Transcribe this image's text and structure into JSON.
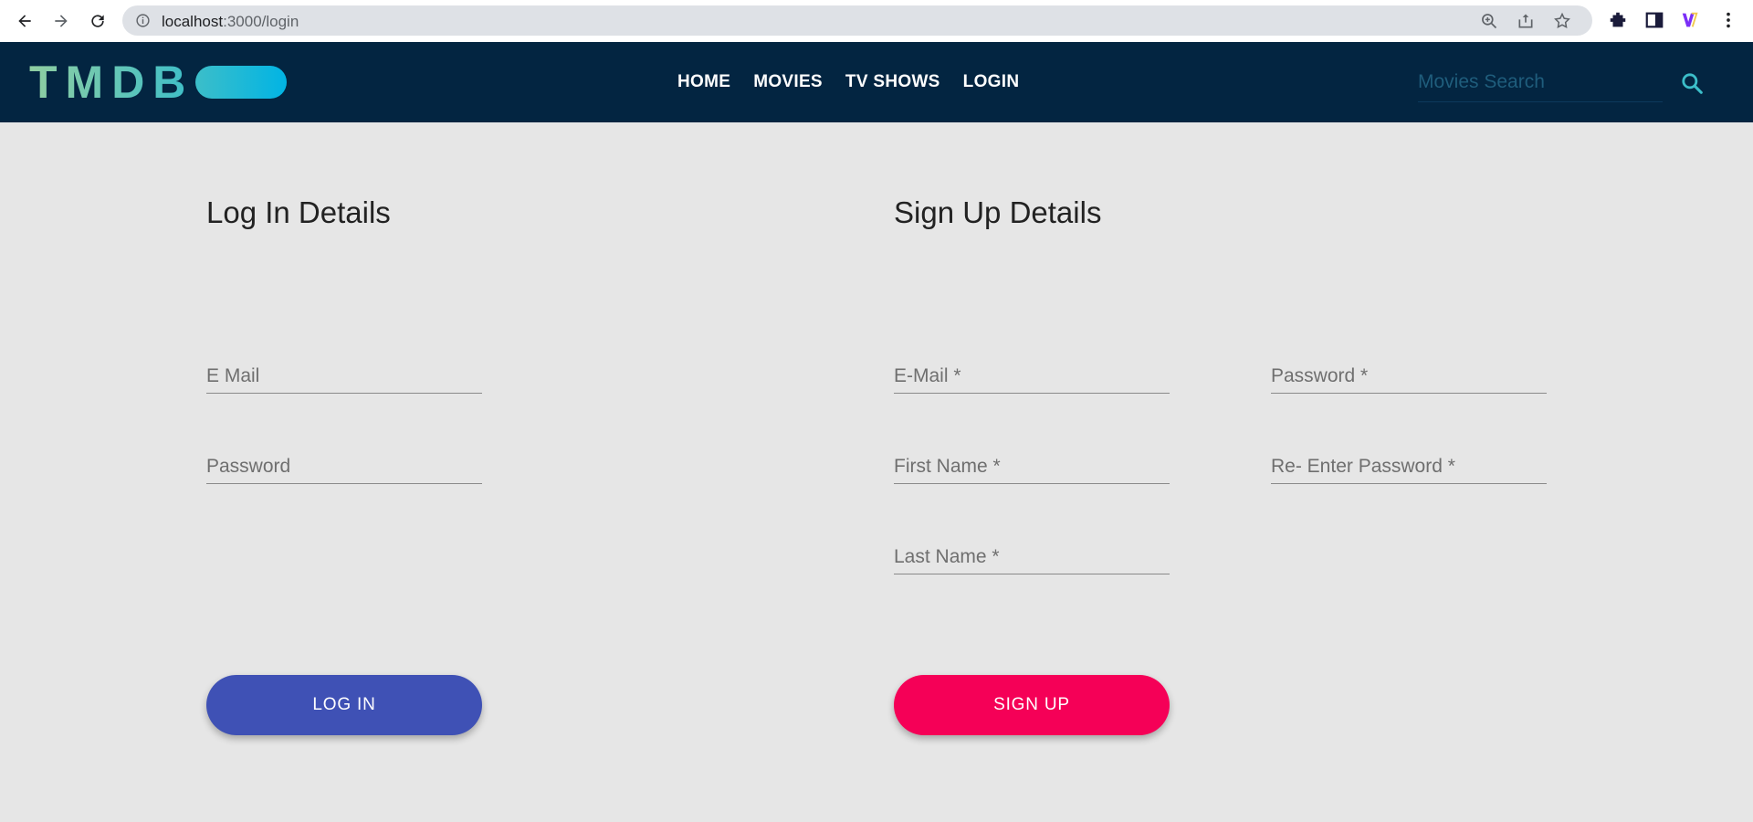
{
  "browser": {
    "url_host": "localhost",
    "url_path": ":3000/login",
    "icons": [
      "back-icon",
      "forward-icon",
      "reload-icon",
      "info-icon",
      "zoom-icon",
      "share-icon",
      "star-icon",
      "extensions-icon",
      "side-panel-icon",
      "profile-extension-icon",
      "menu-icon"
    ]
  },
  "header": {
    "logo_text": "TMDB",
    "nav": [
      "HOME",
      "MOVIES",
      "TV SHOWS",
      "LOGIN"
    ],
    "search_placeholder": "Movies Search",
    "colors": {
      "bar": "#032541",
      "accent": "#3cbec9"
    }
  },
  "login": {
    "title": "Log In Details",
    "email_placeholder": "E Mail",
    "password_placeholder": "Password",
    "button": "LOG IN",
    "button_color": "#3f51b5"
  },
  "signup": {
    "title": "Sign Up Details",
    "email_placeholder": "E-Mail *",
    "password_placeholder": "Password *",
    "first_name_placeholder": "First Name *",
    "reenter_password_placeholder": "Re- Enter Password *",
    "last_name_placeholder": "Last Name *",
    "button": "SIGN UP",
    "button_color": "#f50057"
  }
}
